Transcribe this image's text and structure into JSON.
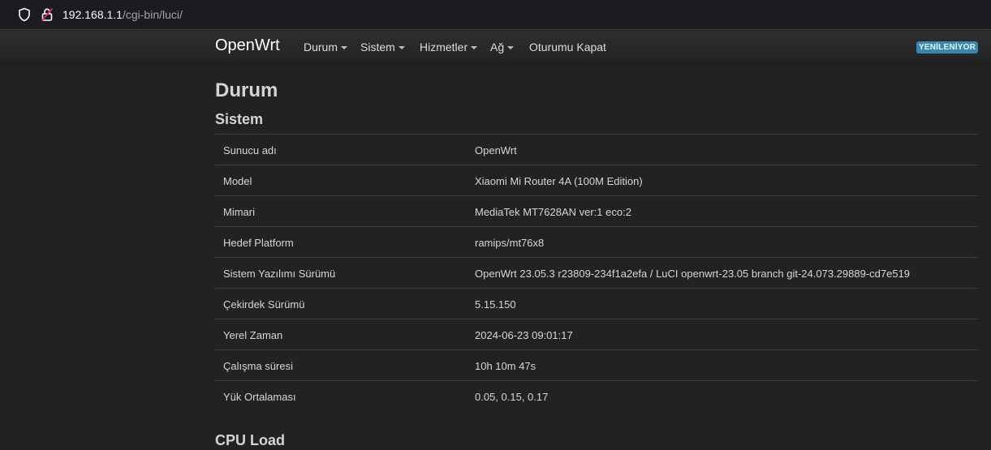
{
  "browser": {
    "url_host": "192.168.1.1",
    "url_path": "/cgi-bin/luci/"
  },
  "navbar": {
    "brand": "OpenWrt",
    "items": [
      {
        "label": "Durum",
        "dropdown": true
      },
      {
        "label": "Sistem",
        "dropdown": true
      },
      {
        "label": "Hizmetler",
        "dropdown": true
      },
      {
        "label": "Ağ",
        "dropdown": true
      },
      {
        "label": "Oturumu Kapat",
        "dropdown": false
      }
    ],
    "badge": "YENİLENİYOR"
  },
  "main": {
    "title": "Durum",
    "system_section": {
      "title": "Sistem",
      "rows": [
        {
          "key": "Sunucu adı",
          "value": "OpenWrt"
        },
        {
          "key": "Model",
          "value": "Xiaomi Mi Router 4A (100M Edition)"
        },
        {
          "key": "Mimari",
          "value": "MediaTek MT7628AN ver:1 eco:2"
        },
        {
          "key": "Hedef Platform",
          "value": "ramips/mt76x8"
        },
        {
          "key": "Sistem Yazılımı Sürümü",
          "value": "OpenWrt 23.05.3 r23809-234f1a2efa / LuCI openwrt-23.05 branch git-24.073.29889-cd7e519"
        },
        {
          "key": "Çekirdek Sürümü",
          "value": "5.15.150"
        },
        {
          "key": "Yerel Zaman",
          "value": "2024-06-23 09:01:17"
        },
        {
          "key": "Çalışma süresi",
          "value": "10h 10m 47s"
        },
        {
          "key": "Yük Ortalaması",
          "value": "0.05, 0.15, 0.17"
        }
      ]
    },
    "cpu_section": {
      "title": "CPU Load"
    }
  },
  "colors": {
    "background": "#222222",
    "badge": "#3a87ad"
  }
}
